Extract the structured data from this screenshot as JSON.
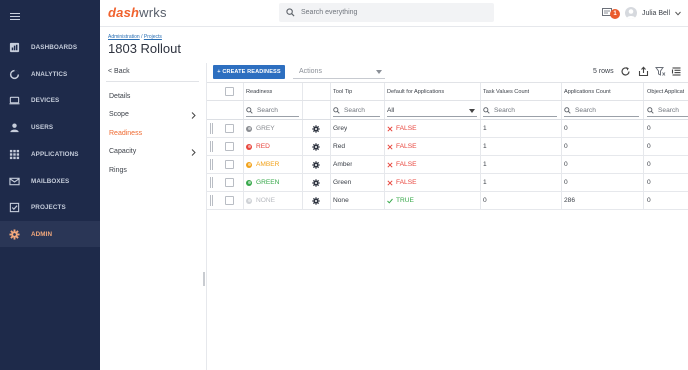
{
  "app": {
    "logo_a": "dash",
    "logo_b": "w",
    "logo_c": "rks",
    "search_placeholder": "Search everything",
    "notification_count": "1",
    "user_name": "Julia Bell"
  },
  "nav": {
    "items": [
      {
        "label": "DASHBOARDS",
        "icon": "dashboards-icon"
      },
      {
        "label": "ANALYTICS",
        "icon": "analytics-icon"
      },
      {
        "label": "DEVICES",
        "icon": "devices-icon"
      },
      {
        "label": "USERS",
        "icon": "users-icon"
      },
      {
        "label": "APPLICATIONS",
        "icon": "applications-icon"
      },
      {
        "label": "MAILBOXES",
        "icon": "mailboxes-icon"
      },
      {
        "label": "PROJECTS",
        "icon": "projects-icon"
      },
      {
        "label": "ADMIN",
        "icon": "admin-gear-icon"
      }
    ],
    "active": "ADMIN",
    "accent": "#f2a87c"
  },
  "page": {
    "breadcrumb_a": "Administration",
    "breadcrumb_sep": " / ",
    "breadcrumb_b": "Projects",
    "title": "1803 Rollout"
  },
  "subnav": {
    "back": "< Back",
    "items": [
      {
        "label": "Details"
      },
      {
        "label": "Scope"
      },
      {
        "label": "Readiness"
      },
      {
        "label": "Capacity"
      },
      {
        "label": "Rings"
      }
    ],
    "active": "Readiness"
  },
  "toolbar": {
    "create_label": "+ CREATE READINESS",
    "actions_label": "Actions",
    "rows_label": "5 rows"
  },
  "grid": {
    "columns": [
      "Readiness",
      "Tool Tip",
      "Default for Applications",
      "Task Values Count",
      "Applications Count",
      "Object Applicat"
    ],
    "filter_placeholder": "Search",
    "filter_select": "All",
    "rows": [
      {
        "readiness": "GREY",
        "color": "#8a8d92",
        "tooltip": "Grey",
        "default": "FALSE",
        "is_default": false,
        "task_count": "1",
        "app_count": "0",
        "obj_app": "0"
      },
      {
        "readiness": "RED",
        "color": "#e8453c",
        "tooltip": "Red",
        "default": "FALSE",
        "is_default": false,
        "task_count": "1",
        "app_count": "0",
        "obj_app": "0"
      },
      {
        "readiness": "AMBER",
        "color": "#f2a21a",
        "tooltip": "Amber",
        "default": "FALSE",
        "is_default": false,
        "task_count": "1",
        "app_count": "0",
        "obj_app": "0"
      },
      {
        "readiness": "GREEN",
        "color": "#37a84a",
        "tooltip": "Green",
        "default": "FALSE",
        "is_default": false,
        "task_count": "1",
        "app_count": "0",
        "obj_app": "0"
      },
      {
        "readiness": "NONE",
        "color": "#cfd2d6",
        "tooltip": "None",
        "default": "TRUE",
        "is_default": true,
        "task_count": "0",
        "app_count": "286",
        "obj_app": "0"
      }
    ]
  },
  "colors": {
    "false": "#e8453c",
    "true": "#37a84a",
    "primary": "#2d6fc0"
  }
}
